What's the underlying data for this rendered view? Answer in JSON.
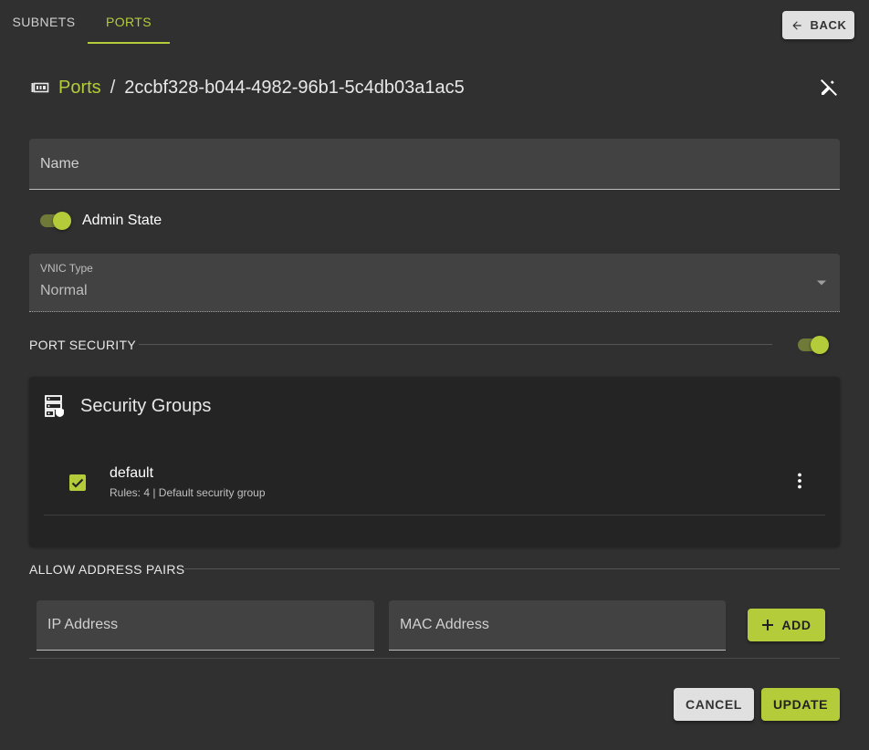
{
  "tabs": [
    {
      "label": "SUBNETS",
      "active": false
    },
    {
      "label": "PORTS",
      "active": true
    }
  ],
  "back_button": {
    "label": "BACK",
    "icon": "arrow-left-icon"
  },
  "breadcrumb": {
    "icon": "ethernet-port-icon",
    "section": "Ports",
    "separator": "/",
    "item": "2ccbf328-b044-4982-96b1-5c4db03a1ac5"
  },
  "close_icon": "edit-off-icon",
  "form": {
    "name": {
      "placeholder": "Name",
      "value": ""
    },
    "admin_state": {
      "label": "Admin State",
      "enabled": true
    },
    "vnic_type": {
      "label": "VNIC Type",
      "value": "Normal"
    },
    "port_security": {
      "label": "PORT SECURITY",
      "enabled": true
    },
    "security_groups": {
      "title": "Security Groups",
      "icon": "server-security-icon",
      "items": [
        {
          "name": "default",
          "description": "Rules: 4 | Default security group",
          "checked": true
        }
      ]
    },
    "allow_address_pairs": {
      "label": "ALLOW ADDRESS PAIRS",
      "ip_placeholder": "IP Address",
      "mac_placeholder": "MAC Address",
      "add_label": "ADD"
    }
  },
  "actions": {
    "cancel": "CANCEL",
    "update": "UPDATE"
  },
  "colors": {
    "accent": "#b4cc3a",
    "background": "#303030",
    "card": "#242424",
    "field": "#424242"
  }
}
